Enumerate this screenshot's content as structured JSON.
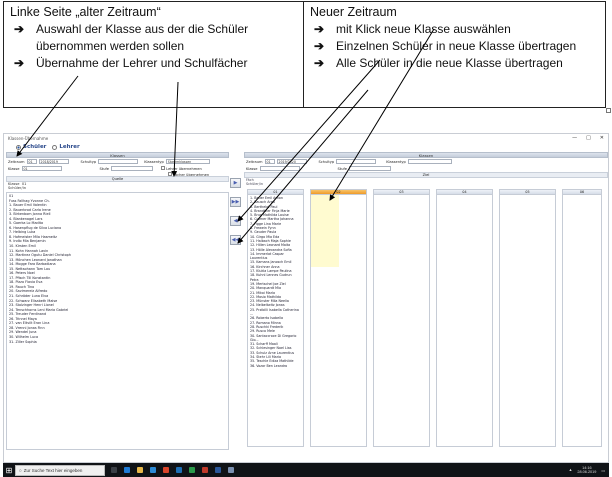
{
  "annotation": {
    "left": {
      "title": "Linke Seite „alter Zeitraum“",
      "items": [
        "Auswahl der Klasse aus der die Schüler übernommen werden sollen",
        "Übernahme der Lehrer und Schulfächer"
      ]
    },
    "right": {
      "title": "Neuer Zeitraum",
      "items": [
        "mit Klick neue Klasse auswählen",
        "Einzelnen Schüler in neue Klasse übertragen",
        "Alle Schüler in die neue Klasse übertragen"
      ]
    }
  },
  "window": {
    "title": "Klassen-Übernahme",
    "modes": [
      "Schüler",
      "Lehrer"
    ],
    "left": {
      "group_title": "Klassen",
      "zeitraum_label": "Zeitraum",
      "zeitraum_from": "01",
      "zeitraum_to": "2018/2019",
      "schultyp_label": "Schultyp",
      "klassentyp_label": "Klassentyp",
      "klassentyp_value": "Stammklassen",
      "klasse_label": "Klasse",
      "klasse_value": "01",
      "stufe_label": "Stufe",
      "lehrer_label": "Lehrer übernehmen",
      "faecher_label": "Fächer übernehmen",
      "quelle_label": "Quelle",
      "list_head_1": "Klasse",
      "list_head_2": "01",
      "list_head_3": "Schüler/in",
      "list_title": "01",
      "students": [
        "Fuss Fallhag Yvonne Ch.",
        "1. Bauer Emil Valentin",
        "2. Bauerbrod Carla Irene",
        "3. Birkenbom Jonna Riell",
        "4. Blankenagel Lars",
        "5. Goerka Lo Madita",
        "6. Hasenpflug de Silva Luciano",
        "7. Helbing Luka",
        "8. Hofmeister Mila Hasmeitz",
        "9. Indlo Mia Benjamin",
        "10. Kirsten Emil",
        "11. Kohn Hannah Lavin",
        "12. Martinez Ogutu Daniel Christoph",
        "13. Mönchen Leonard Jonathan",
        "14. Mogge Fara Barbadiana",
        "15. Nettsohann Tom Lou",
        "16. Peters Noel",
        "17. Pfisch Till Konstantin",
        "18. Pizzo Flavia Eva",
        "19. Rauch Tino",
        "20. Savimerelz Alfredo",
        "21. Schröder Luna Elva",
        "22. Schwarz Elisabeth Maise",
        "23. Stolzinger Henri Lionel",
        "24. Tenschhorns Leni Maria Gabriel",
        "25. Treuder Ferdinand",
        "26. Trinnel Maya",
        "27. van Eltvilt Eran Lina",
        "28. Vrenni Jonas Finn",
        "29. Wendel Juna",
        "30. Wilhelm Luca",
        "31. Ziller Sophia"
      ]
    },
    "right": {
      "group_title": "Klassen",
      "zeitraum_label": "Zeitraum",
      "zeitraum_from": "01",
      "zeitraum_to": "2019/2020",
      "schultyp_label": "Schultyp",
      "klassentyp_label": "Klassentyp",
      "klasse_label": "Klasse",
      "stufe_label": "Stufe",
      "ziel_label": "Ziel",
      "small_1": "Fäch",
      "small_2": "Fach",
      "small_3": "Schüler/in",
      "columns": [
        "01",
        "02",
        "03",
        "04",
        "05",
        "06"
      ],
      "students_col1": [
        "1. Bauer Emil Anton",
        "2. Bausch Arno",
        "3. Berthelot Paul",
        "4. Brandtner Finja Marie",
        "5. Brun Mathilda Louise",
        "6. Cramer Martha Johanna",
        "7. Figge Lina Marie",
        "8. Frewein Fynn",
        "9. Geuder Paula",
        "10. Girgo Mia Eda",
        "11. Halbach Maja Sophie",
        "12. Hillen Leonard Maita",
        "13. Hölle Alexandra Sofia",
        "14. Immerlat Caspar Laurentius",
        "15. Kamans Janosch Emil",
        "16. Kirchner Anna",
        "17. Klukla Lampe Paulina",
        "18. Kuhnl Lennes Gudrun Petra",
        "19. Mertschel Joe Ziel",
        "20. Manquardt Mia",
        "21. Mikoi Marla",
        "22. Mosio Mathilda",
        "23. Münster Mila Neelia",
        "24. Nelbeltwitz Jonas",
        "25. Przibilli Isabella Catherina ...",
        "26. Roberto Isabella",
        "27. Romano Minna",
        "28. Ruschki Frederik",
        "29. Rusco Mele",
        "30. Santaccroce Di Gregorio Gio...",
        "31. Scharff Maali",
        "32. Schlesinger Noel Lias",
        "33. Schulz Arne Laurentius",
        "34. Stehr Lili Maria",
        "35. Teschle Ediza Mathilde",
        "36. Vozar Ben Leandro"
      ]
    }
  },
  "taskbar": {
    "search_placeholder": "Zur Suche Text hier eingeben",
    "time": "14:16",
    "date": "28.06.2019"
  },
  "colors": {
    "accent": "#2b4a8c",
    "selected_header": "#ee9b2a",
    "highlight": "#fffbd0"
  }
}
